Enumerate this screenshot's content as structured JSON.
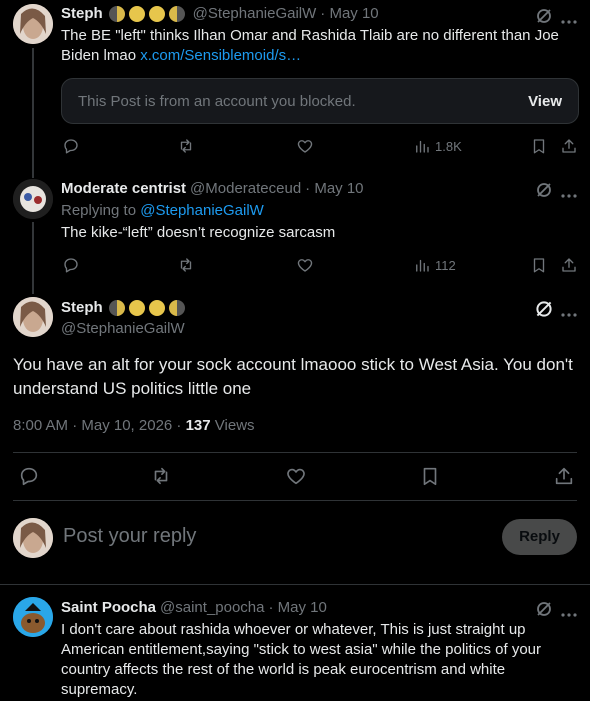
{
  "tweet1": {
    "name": "Steph",
    "handle": "@StephanieGailW",
    "date": "· May 10",
    "text": "The BE \"left\" thinks Ilhan Omar and Rashida Tlaib are no different than Joe Biden lmao",
    "link": "x.com/Sensiblemoid/s…",
    "blocked_notice": "This Post is from an account you blocked.",
    "view_label": "View",
    "views": "1.8K"
  },
  "tweet2": {
    "name": "Moderate centrist",
    "handle": "@Moderateceud",
    "date": "· May 10",
    "replying_prefix": "Replying to",
    "replying_to": "@StephanieGailW",
    "text": "The kike-“left” doesn’t recognize sarcasm",
    "views": "112"
  },
  "main": {
    "name": "Steph",
    "handle": "@StephanieGailW",
    "text": "You have an alt for your sock account lmaooo stick to West Asia. You don't understand US politics little one",
    "timestamp": "8:00 AM · May 10, 2026 · ",
    "views_count": "137",
    "views_label": " Views"
  },
  "reply_box": {
    "placeholder": "Post your reply",
    "button_label": "Reply"
  },
  "tweet3": {
    "name": "Saint Poocha",
    "handle": "@saint_poocha",
    "date": "· May 10",
    "text": "I don't care about rashida whoever or whatever, This is just straight up American entitlement,saying \"stick to west asia\" while the politics of your country affects the rest of the world is peak eurocentrism and white supremacy."
  },
  "colors": {
    "background": "#000000",
    "accent": "#1d9bf0",
    "muted": "#71767b",
    "text": "#e7e9ea"
  }
}
